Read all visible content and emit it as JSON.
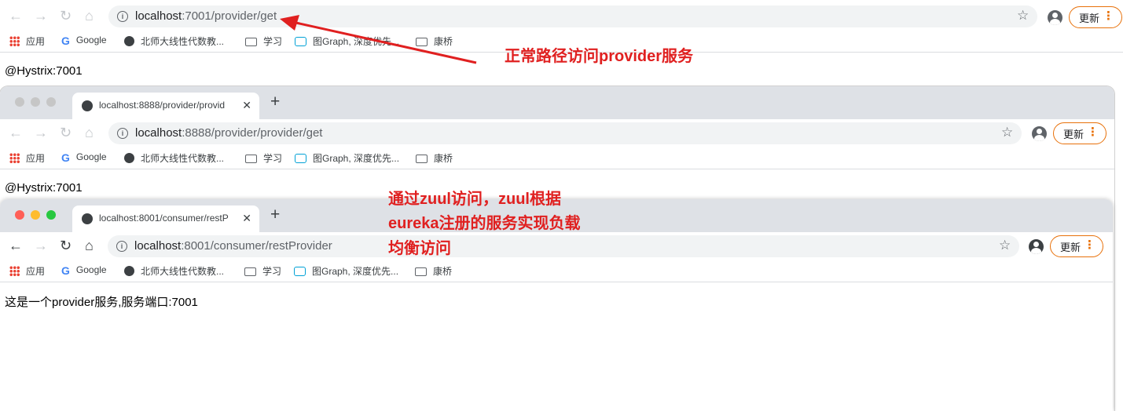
{
  "win1": {
    "url_host": "localhost",
    "url_path": ":7001/provider/get",
    "update_label": "更新",
    "content_text": "@Hystrix:7001"
  },
  "win2": {
    "tab_title": "localhost:8888/provider/provid",
    "url_host": "localhost",
    "url_path": ":8888/provider/provider/get",
    "update_label": "更新",
    "content_text": "@Hystrix:7001"
  },
  "win3": {
    "tab_title": "localhost:8001/consumer/restP",
    "url_host": "localhost",
    "url_path": ":8001/consumer/restProvider",
    "update_label": "更新",
    "content_text": "这是一个provider服务,服务端口:7001"
  },
  "bookmarks": [
    {
      "label": "应用",
      "icon": "apps-icon"
    },
    {
      "label": "Google",
      "icon": "google-icon"
    },
    {
      "label": "北师大线性代数教...",
      "icon": "globe-icon"
    },
    {
      "label": "学习",
      "icon": "folder-icon"
    },
    {
      "label": "图Graph, 深度优先...",
      "icon": "bilibili-icon"
    },
    {
      "label": "康桥",
      "icon": "folder-icon"
    }
  ],
  "annotations": {
    "top": "正常路径访问provider服务",
    "middle_line1": "通过zuul访问，zuul根据",
    "middle_line2": "eureka注册的服务实现负载",
    "middle_line3": "均衡访问"
  },
  "colors": {
    "annotation_red": "#e02020",
    "update_orange": "#e8710a",
    "tabstrip_gray": "#dee1e6"
  }
}
